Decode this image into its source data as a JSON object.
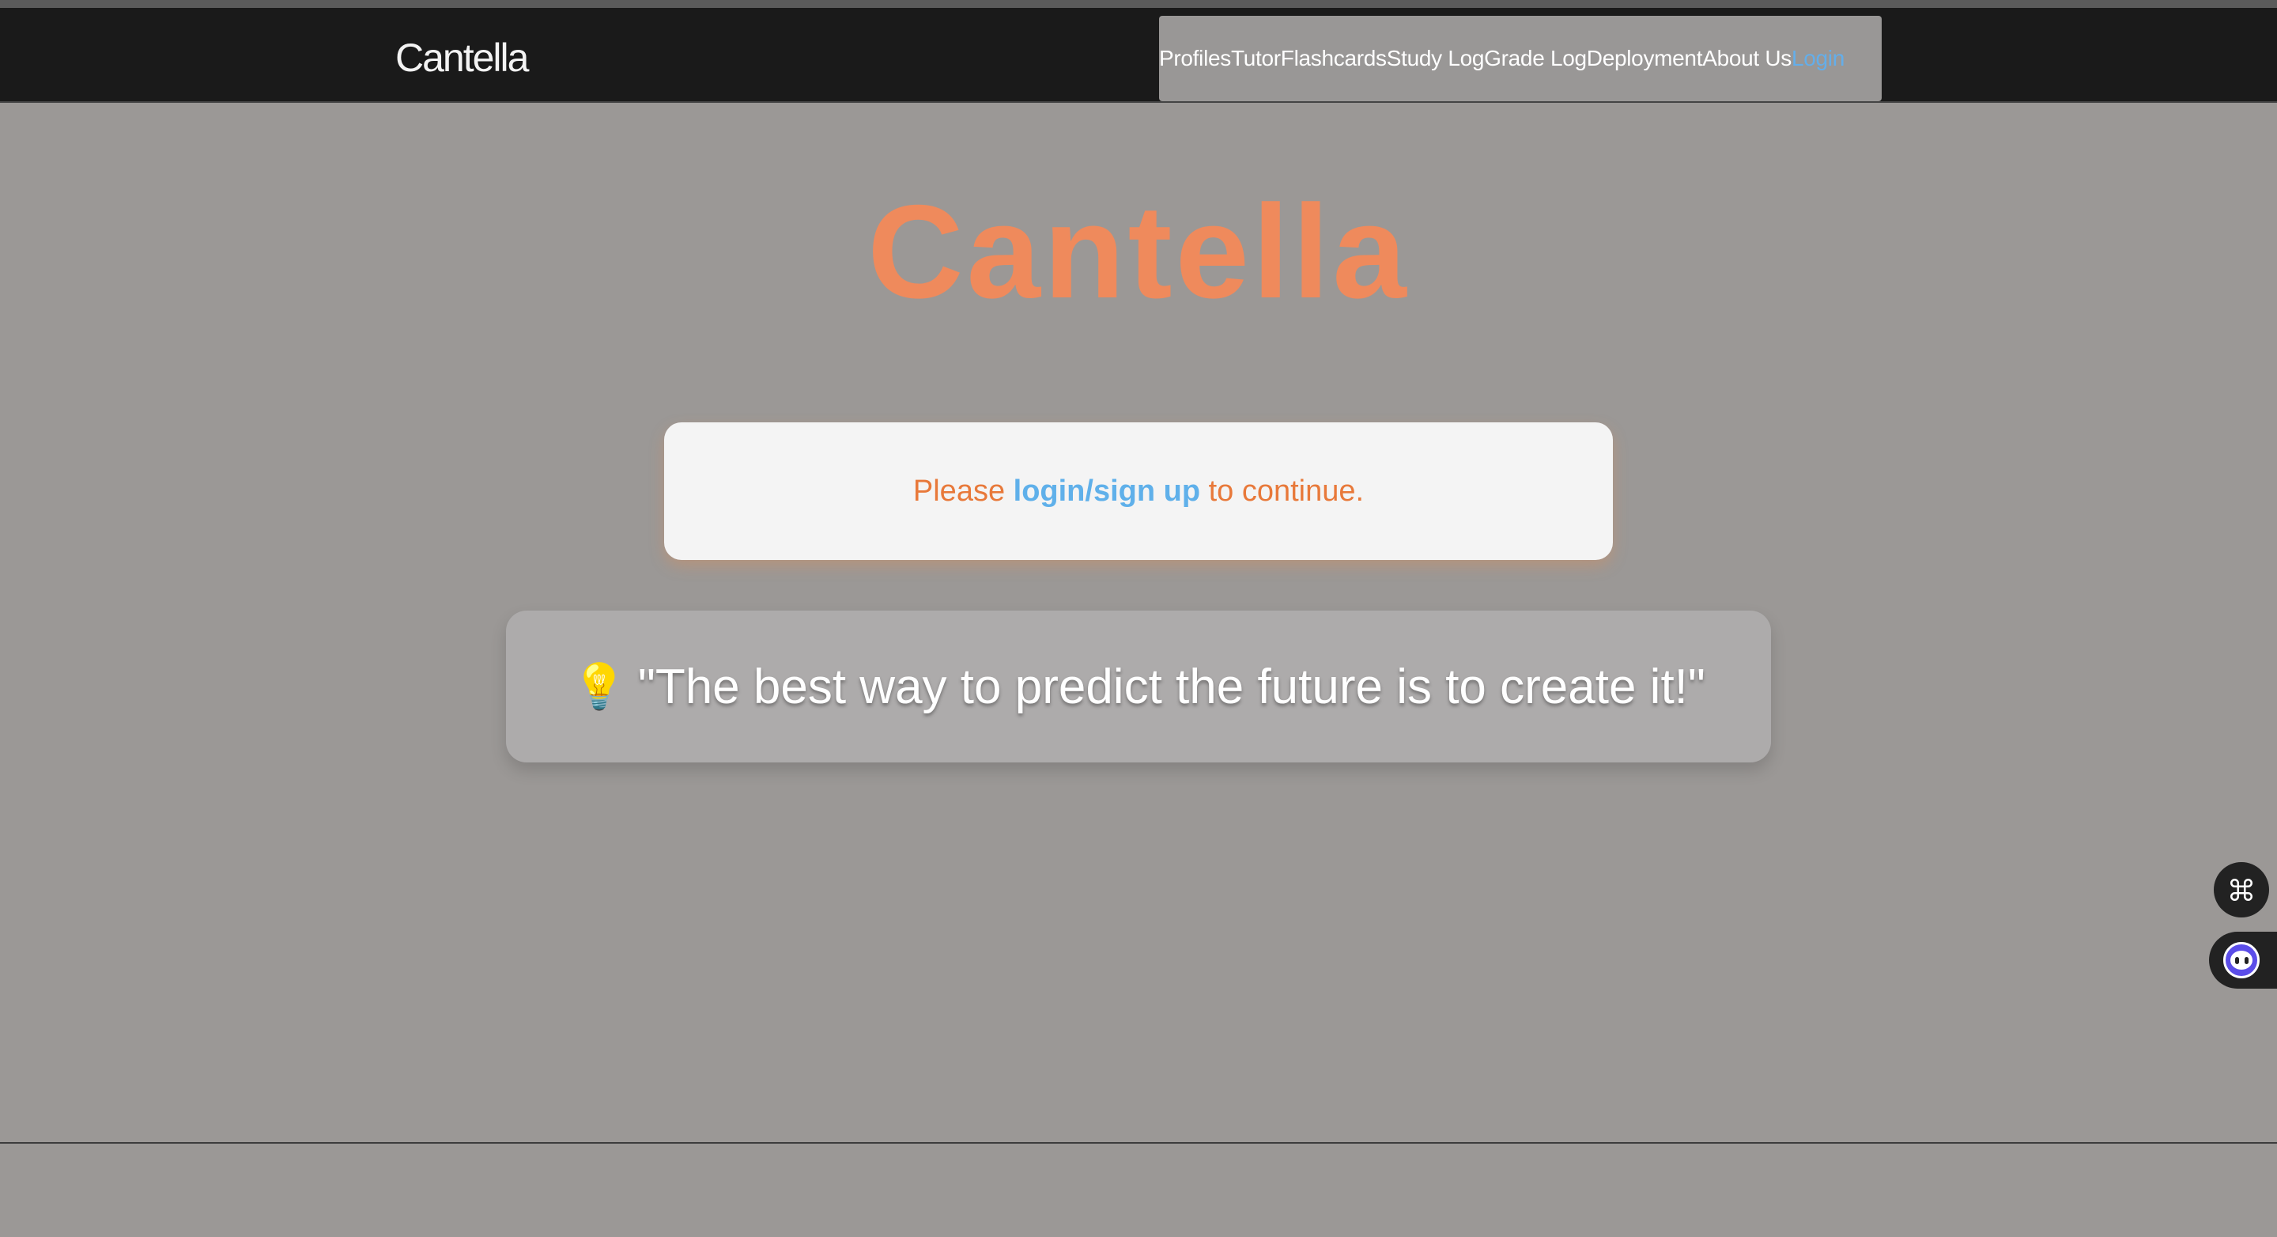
{
  "app": {
    "brand": "Cantella"
  },
  "nav": {
    "items": [
      {
        "label": "Profiles",
        "active": false
      },
      {
        "label": "Tutor",
        "active": false
      },
      {
        "label": "Flashcards",
        "active": false
      },
      {
        "label": "Study Log",
        "active": false
      },
      {
        "label": "Grade Log",
        "active": false
      },
      {
        "label": "Deployment",
        "active": false
      },
      {
        "label": "About Us",
        "active": false
      },
      {
        "label": "Login",
        "active": true
      }
    ]
  },
  "hero": {
    "title": "Cantella"
  },
  "login_prompt": {
    "prefix": "Please ",
    "link": "login/sign up",
    "suffix": " to continue."
  },
  "quote": {
    "icon": "lightbulb-icon",
    "emoji": "💡",
    "text": "\"The best way to predict the future is to create it!\""
  },
  "widgets": {
    "shortcuts_icon": "command-key-icon",
    "assistant_icon": "assistant-bot-icon"
  },
  "colors": {
    "accent": "#ef8a5c",
    "link": "#5fb0ea",
    "navbar": "#1a1a1a",
    "background": "#9b9896"
  }
}
